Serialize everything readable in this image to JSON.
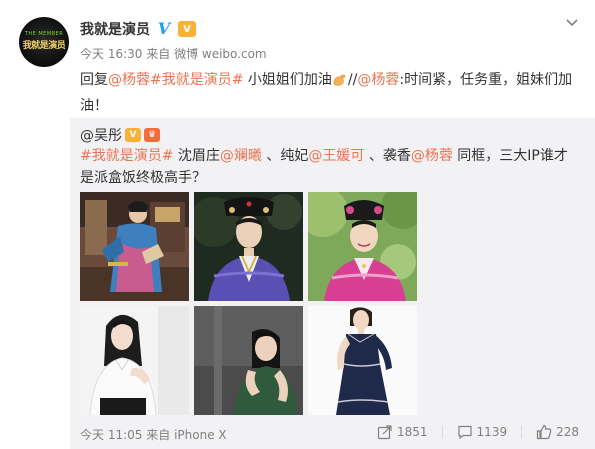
{
  "account": {
    "name": "我就是演员",
    "avatar_small_text": "THE MEMBER",
    "avatar_logo_text": "我就是演员",
    "meta_time": "今天 16:30",
    "meta_from": "来自",
    "meta_source": "微博 weibo.com",
    "verified_icon": "v-verified-icon",
    "vip_icon": "vip-icon"
  },
  "post": {
    "reply_prefix": "回复",
    "mention1": "@杨蓉",
    "tag1": "#我就是演员#",
    "text_mid": " 小姐姐们加油",
    "emoji": "muscle-emoji",
    "double_slash": "//",
    "mention2": "@杨蓉",
    "text_end": ":时间紧，任务重，姐妹们加油！"
  },
  "repost": {
    "author": "@吴彤",
    "tag": "#我就是演员#",
    "text1": " 沈眉庄",
    "mention_a": "@斓曦",
    "text2": " 、纯妃",
    "mention_b": "@王媛可",
    "text3": " 、袭香",
    "mention_c": "@杨蓉",
    "text4": " 同框，三大IP谁才是派盒饭终极高手？",
    "time": "今天 11:05",
    "from": "来自",
    "source": "iPhone X",
    "images": [
      "image-1",
      "image-2",
      "image-3",
      "image-4",
      "image-5",
      "image-6"
    ]
  },
  "actions": {
    "forward_count": "1851",
    "comment_count": "1139",
    "like_count": "228"
  },
  "colors": {
    "link": "#eb7350",
    "meta": "#808080",
    "repost_bg": "#f2f2f5",
    "verified": "#1ba1f2"
  }
}
